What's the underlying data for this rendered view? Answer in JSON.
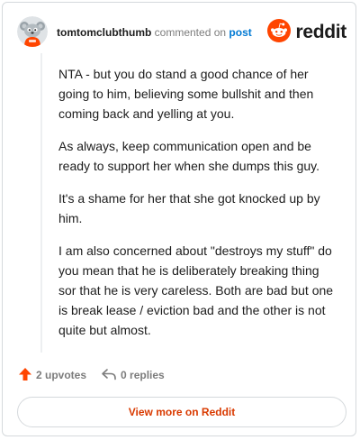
{
  "header": {
    "username": "tomtomclubthumb",
    "action_text": "commented on",
    "target_text": "post",
    "brand_name": "reddit",
    "brand_color": "#ff4500"
  },
  "comment": {
    "paragraphs": [
      "NTA - but you do stand a good chance of her going to him, believing some bullshit and then coming back and yelling at you.",
      "As always, keep communication open and be ready to support her when she dumps this guy.",
      "It's a shame for her that she got knocked up by him.",
      "I am also concerned about \"destroys my stuff\" do you mean that he is deliberately breaking thing sor that he is very careless. Both are bad but one is break lease / eviction bad and the other is not quite but almost."
    ]
  },
  "footer": {
    "upvotes_label": "2 upvotes",
    "replies_label": "0 replies",
    "upvote_color": "#ff4500"
  },
  "cta": {
    "view_more_label": "View more on Reddit",
    "color": "#d93a00"
  },
  "icons": {
    "avatar": "snoo-avatar-icon",
    "brand": "reddit-logo-icon",
    "upvote": "upvote-arrow-icon",
    "reply": "reply-arrow-icon"
  }
}
